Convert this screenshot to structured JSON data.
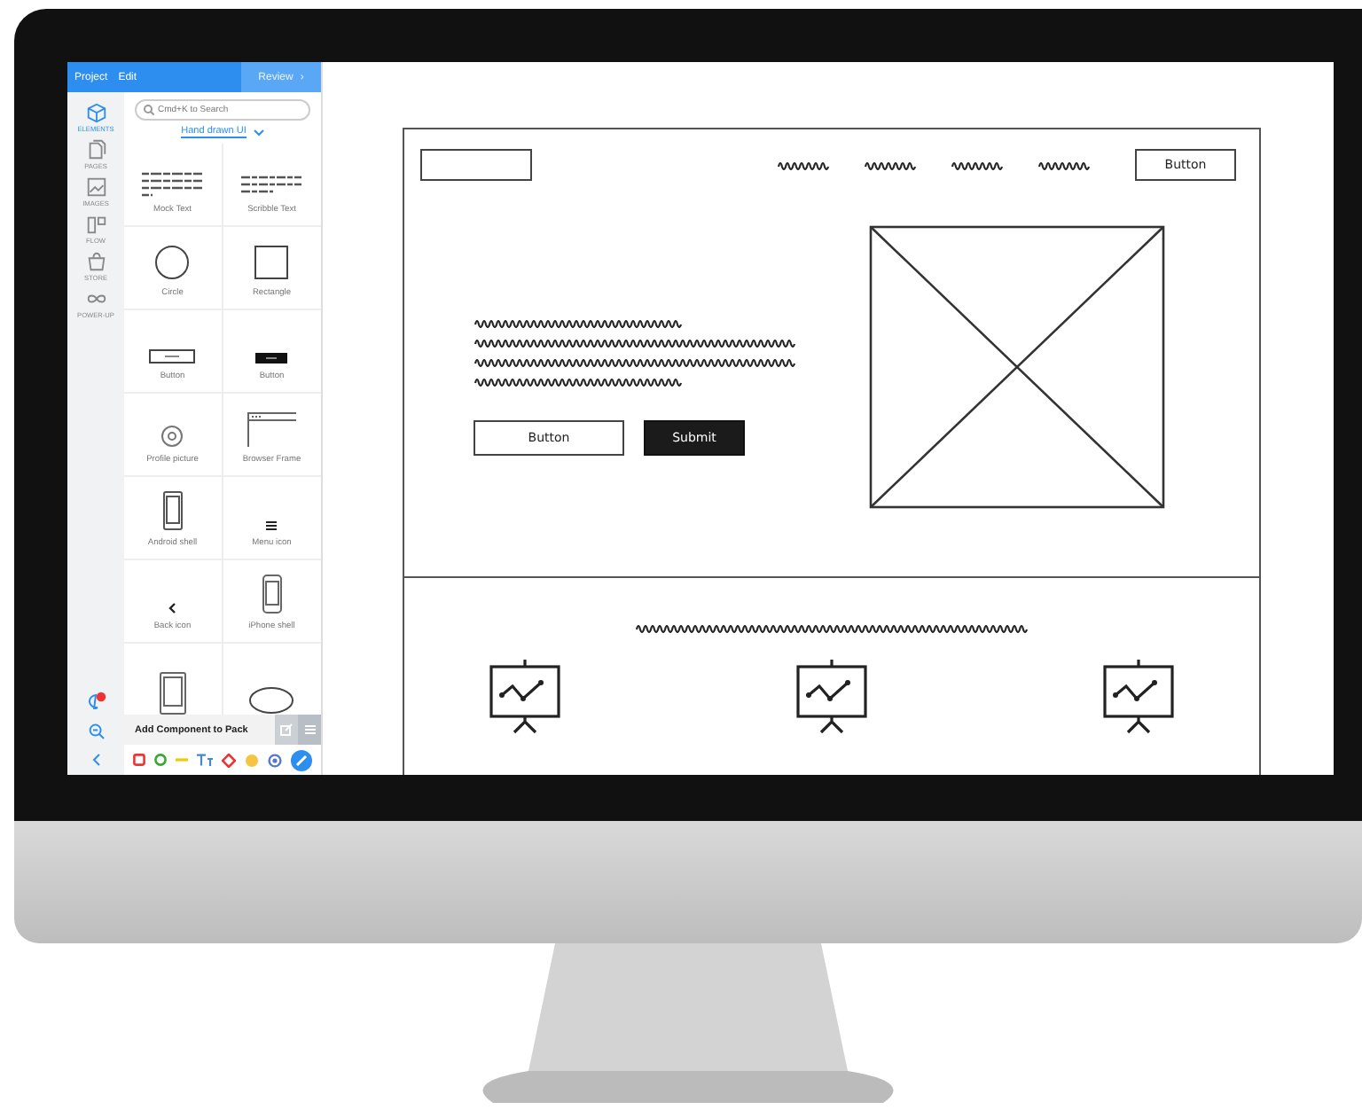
{
  "sidebar": {
    "menu": [
      {
        "label": "Project"
      },
      {
        "label": "Edit"
      }
    ],
    "review_button": {
      "label": "Review",
      "chevron": "›"
    },
    "rail": [
      {
        "label": "ELEMENTS",
        "selected": true
      },
      {
        "label": "PAGES",
        "selected": false
      },
      {
        "label": "IMAGES",
        "selected": false
      },
      {
        "label": "FLOW",
        "selected": false
      },
      {
        "label": "STORE",
        "selected": false
      },
      {
        "label": "POWER-UP",
        "selected": false
      }
    ],
    "search": {
      "placeholder": "Cmd+K to Search"
    },
    "library": "Hand drawn UI",
    "components": [
      {
        "kind": "mock-text",
        "label": "Mock Text"
      },
      {
        "kind": "scribble-text",
        "label": "Scribble Text"
      },
      {
        "kind": "circle",
        "label": "Circle"
      },
      {
        "kind": "rectangle",
        "label": "Rectangle"
      },
      {
        "kind": "button-outline",
        "label": "Button"
      },
      {
        "kind": "button-dark",
        "label": "Button"
      },
      {
        "kind": "profile",
        "label": "Profile picture"
      },
      {
        "kind": "browser",
        "label": "Browser Frame"
      },
      {
        "kind": "android",
        "label": "Android shell"
      },
      {
        "kind": "menu-icon",
        "label": "Menu icon"
      },
      {
        "kind": "back-icon",
        "label": "Back icon"
      },
      {
        "kind": "iphone",
        "label": "iPhone shell"
      },
      {
        "kind": "tablet"
      },
      {
        "kind": "ellipse"
      }
    ],
    "footer": {
      "label": "Add Component to Pack"
    }
  },
  "wireframe": {
    "header_button": "Button",
    "hero_buttons": [
      {
        "kind": "outline",
        "label": "Button"
      },
      {
        "kind": "filled",
        "label": "Submit"
      }
    ]
  }
}
